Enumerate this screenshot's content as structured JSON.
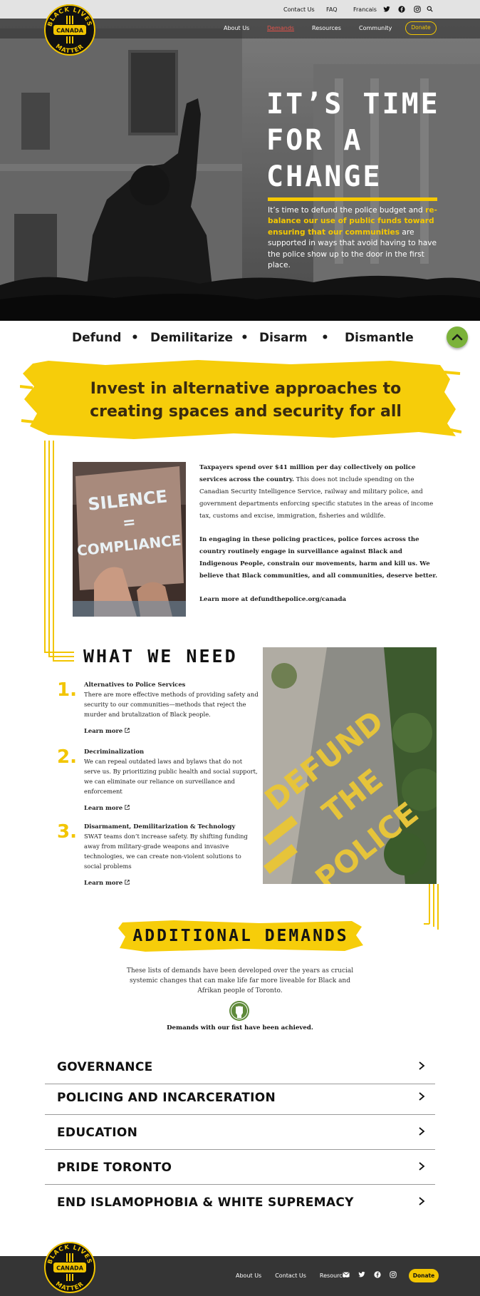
{
  "topbar": {
    "links": [
      "Contact Us",
      "FAQ",
      "Francais"
    ],
    "icons": [
      "twitter-icon",
      "facebook-icon",
      "instagram-icon",
      "search-icon"
    ]
  },
  "logo": {
    "top_text": "BLACK LIVES",
    "center_text": "CANADA",
    "bottom_text": "MATTER"
  },
  "nav": {
    "items": [
      "About Us",
      "Demands",
      "Resources",
      "Community"
    ],
    "active": "Demands",
    "donate_label": "Donate"
  },
  "hero": {
    "title_lines": [
      "IT’S TIME",
      "FOR A",
      "CHANGE"
    ],
    "text_before": "It’s time to defund the police budget and ",
    "text_highlight": "re-balance our use of public funds toward ensuring that our communities",
    "text_after": " are supported in ways that avoid having to have the police show up to the door in the first place."
  },
  "pillars": [
    "Defund",
    "Demilitarize",
    "Disarm",
    "Dismantle"
  ],
  "pillar_separator": "•",
  "banner": {
    "text": "Invest in alternative approaches to creating spaces and security for all"
  },
  "intro": {
    "p1_bold": "Taxpayers spend over $41 million per day collectively on police services across the country.",
    "p1_rest": " This does not include spending on the Canadian Security Intelligence Service, railway and military police, and government departments enforcing specific statutes in the areas of income tax, customs and excise, immigration, fisheries and wildlife.",
    "p2": "In engaging in these policing practices, police forces across the country routinely engage in surveillance against Black and Indigenous People, constrain our movements, harm and kill us. We believe that Black communities, and all communities, deserve better.",
    "p3": "Learn more at defundthepolice.org/canada"
  },
  "silence_photo": {
    "sign_line1": "SILENCE",
    "sign_line2": "=",
    "sign_line3": "COMPLIANCE"
  },
  "what_we_need": {
    "title": "WHAT WE NEED",
    "items": [
      {
        "num": "1.",
        "title": "Alternatives to Police Services",
        "text": "There are more effective methods of providing safety and security to our communities—methods that reject the murder and brutalization of Black people.",
        "link": "Learn more"
      },
      {
        "num": "2.",
        "title": "Decriminalization",
        "text": "We can repeal outdated laws and bylaws that do not serve us. By prioritizing public health and social support, we can eliminate our reliance on surveillance and enforcement",
        "link": "Learn more"
      },
      {
        "num": "3.",
        "title": "Disarmament, Demilitarization & Technology",
        "text": "SWAT teams don’t increase safety. By shifting funding away from military-grade weapons and invasive technologies, we can create non-violent solutions to social problems",
        "link": "Learn more"
      }
    ]
  },
  "street_photo": {
    "words": [
      "DEFUND",
      "THE",
      "POLICE"
    ]
  },
  "additional": {
    "title": "ADDITIONAL DEMANDS",
    "description": "These lists of demands have been developed over the years as crucial systemic changes that can make life far more liveable for Black and Afrikan people of Toronto.",
    "achieved_note": "Demands with our fist have been achieved."
  },
  "accordion": [
    "GOVERNANCE",
    "POLICING AND INCARCERATION",
    "EDUCATION",
    "PRIDE TORONTO",
    "END ISLAMOPHOBIA & WHITE SUPREMACY"
  ],
  "footer": {
    "links": [
      "About Us",
      "Contact Us",
      "Resources"
    ],
    "icons": [
      "mail-icon",
      "twitter-icon",
      "facebook-icon",
      "instagram-icon"
    ],
    "donate_label": "Donate"
  },
  "colors": {
    "accent_yellow": "#f5c800",
    "active_nav": "#e6524a",
    "back_to_top_green": "#7bb23a",
    "footer_bg": "#353535"
  }
}
